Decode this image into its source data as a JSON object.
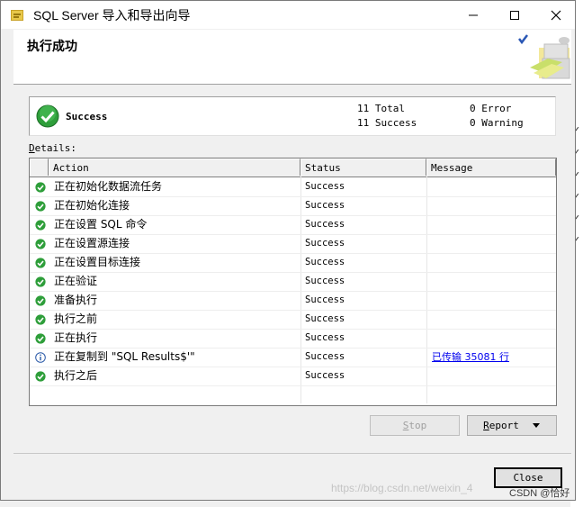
{
  "window": {
    "title": "SQL Server 导入和导出向导"
  },
  "header": {
    "title": "执行成功"
  },
  "summary": {
    "status": "Success",
    "total_label": "11 Total",
    "success_label": "11 Success",
    "error_label": "0 Error",
    "warning_label": "0 Warning"
  },
  "details": {
    "label_prefix": "D",
    "label_rest": "etails:",
    "columns": [
      "Action",
      "Status",
      "Message"
    ],
    "rows": [
      {
        "icon": "success-icon",
        "action": "正在初始化数据流任务",
        "status": "Success",
        "message": ""
      },
      {
        "icon": "success-icon",
        "action": "正在初始化连接",
        "status": "Success",
        "message": ""
      },
      {
        "icon": "success-icon",
        "action": "正在设置 SQL 命令",
        "status": "Success",
        "message": ""
      },
      {
        "icon": "success-icon",
        "action": "正在设置源连接",
        "status": "Success",
        "message": ""
      },
      {
        "icon": "success-icon",
        "action": "正在设置目标连接",
        "status": "Success",
        "message": ""
      },
      {
        "icon": "success-icon",
        "action": "正在验证",
        "status": "Success",
        "message": ""
      },
      {
        "icon": "success-icon",
        "action": "准备执行",
        "status": "Success",
        "message": ""
      },
      {
        "icon": "success-icon",
        "action": "执行之前",
        "status": "Success",
        "message": ""
      },
      {
        "icon": "success-icon",
        "action": "正在执行",
        "status": "Success",
        "message": ""
      },
      {
        "icon": "info-icon",
        "action": "正在复制到 \"SQL Results$'\"",
        "status": "Success",
        "message": "已传输 35081 行"
      },
      {
        "icon": "success-icon",
        "action": "执行之后",
        "status": "Success",
        "message": ""
      }
    ]
  },
  "buttons": {
    "stop_u": "S",
    "stop_rest": "top",
    "report_u": "R",
    "report_rest": "eport",
    "close": "Close"
  },
  "watermark": {
    "text": "https://blog.csdn.net/weixin_4",
    "badge": "CSDN @恰好"
  },
  "colors": {
    "success_green": "#2e9e3a",
    "info_blue": "#2b5aa8",
    "link": "#0000ee"
  }
}
